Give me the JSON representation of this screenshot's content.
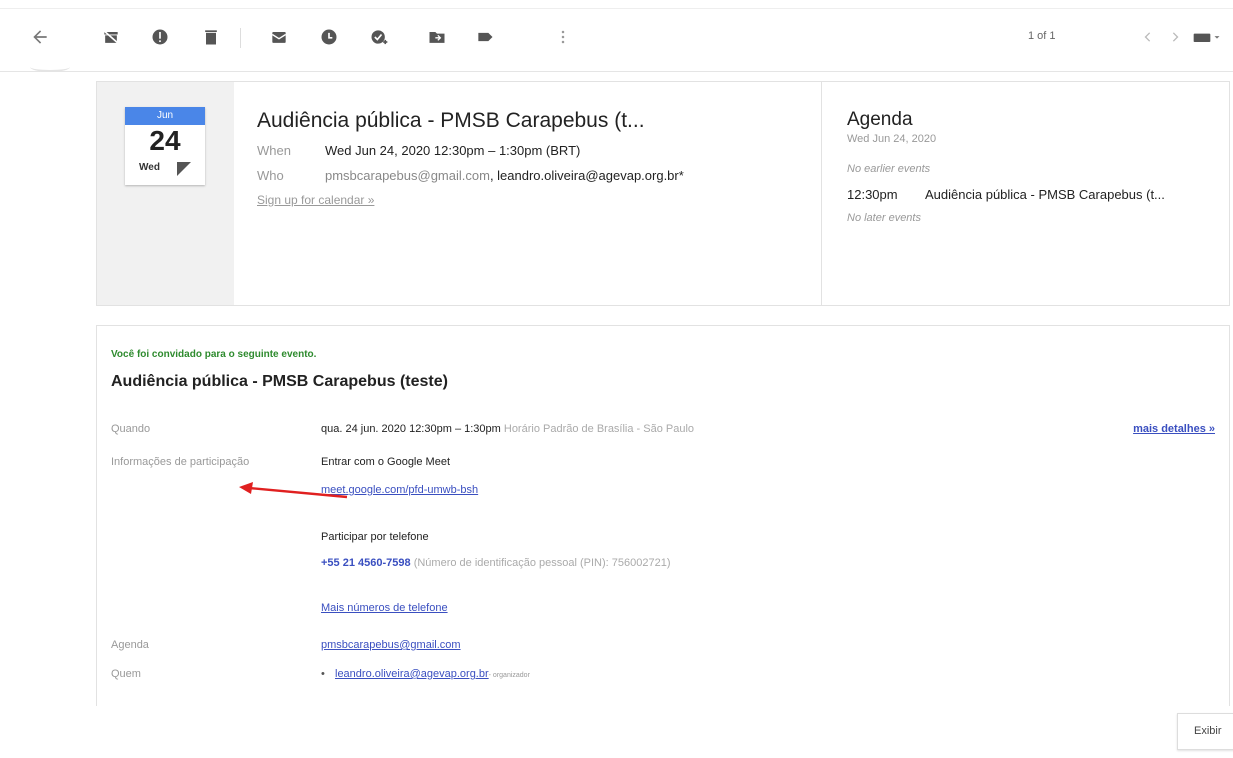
{
  "toolbar": {
    "icons": [
      "back-arrow-icon",
      "archive-icon",
      "report-spam-icon",
      "delete-icon",
      "mark-unread-icon",
      "snooze-icon",
      "add-task-icon",
      "move-to-icon",
      "label-icon",
      "more-vert-icon"
    ],
    "pager": "1 of 1"
  },
  "calendar": {
    "month": "Jun",
    "day": "24",
    "weekday": "Wed",
    "title": "Audiência pública - PMSB Carapebus (t...",
    "when_label": "When",
    "when_value": "Wed Jun 24, 2020 12:30pm – 1:30pm (BRT)",
    "who_label": "Who",
    "who_value_1": "pmsbcarapebus@gmail.com",
    "who_value_2": ", leandro.oliveira@agevap.org.br*",
    "signup": "Sign up for calendar »"
  },
  "agenda": {
    "title": "Agenda",
    "date": "Wed Jun 24, 2020",
    "no_earlier": "No earlier events",
    "event_time": "12:30pm",
    "event_name": "Audiência pública - PMSB Carapebus (t...",
    "no_later": "No later events"
  },
  "invite": {
    "notice": "Você foi convidado para o seguinte evento.",
    "title": "Audiência pública - PMSB Carapebus (teste)",
    "quando_label": "Quando",
    "quando_value": "qua. 24 jun. 2020 12:30pm – 1:30pm",
    "quando_tz": "Horário Padrão de Brasília - São Paulo",
    "more_details": "mais detalhes »",
    "participacao_label": "Informações de participação",
    "meet_text": "Entrar com o Google Meet",
    "meet_link": "meet.google.com/pfd-umwb-bsh",
    "phone_text": "Participar por telefone",
    "phone_number": "+55 21 4560-7598",
    "phone_pin": "(Número de identificação pessoal (PIN): 756002721)",
    "more_numbers": "Mais números de telefone",
    "agenda_label": "Agenda",
    "agenda_value": "pmsbcarapebus@gmail.com",
    "quem_label": "Quem",
    "organizer_email": "leandro.oliveira@agevap.org.br",
    "organizer_role": "- organizador"
  },
  "bottom": {
    "exibir": "Exibir"
  },
  "colors": {
    "accent_blue": "#4a86e8",
    "link": "#3a4fc0",
    "notice_green": "#2e8b2e",
    "annotation_red": "#e02020"
  }
}
